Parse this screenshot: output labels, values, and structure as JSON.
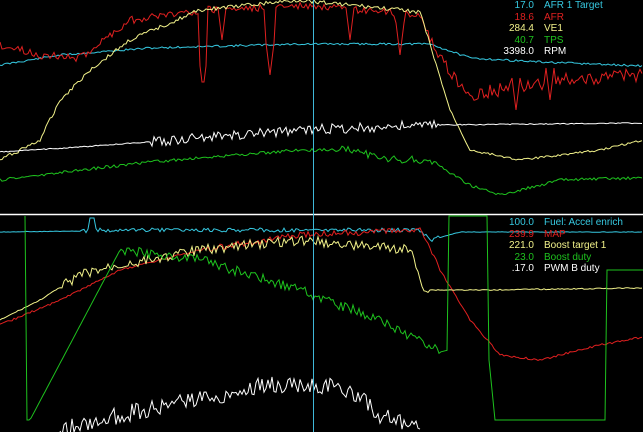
{
  "colors": {
    "background": "#000000",
    "cursor": "#3fb8d8",
    "divider": "#ffffff",
    "cyan": "#36c8e0",
    "red": "#e02020",
    "yellow": "#f2f28a",
    "green": "#1ec21e",
    "white": "#ffffff"
  },
  "panels": [
    {
      "id": "top",
      "channels": [
        {
          "value": "17.0",
          "name": "AFR 1 Target",
          "color": "#36c8e0"
        },
        {
          "value": "18.6",
          "name": "AFR",
          "color": "#e02020"
        },
        {
          "value": "284.4",
          "name": "VE1",
          "color": "#f2f28a"
        },
        {
          "value": "40.7",
          "name": "TPS",
          "color": "#1ec21e"
        },
        {
          "value": "3398.0",
          "name": "RPM",
          "color": "#ffffff"
        }
      ]
    },
    {
      "id": "bottom",
      "channels": [
        {
          "value": "100.0",
          "name": "Fuel: Accel enrich",
          "color": "#36c8e0"
        },
        {
          "value": "239.9",
          "name": "MAP",
          "color": "#e02020"
        },
        {
          "value": "221.0",
          "name": "Boost target 1",
          "color": "#f2f28a"
        },
        {
          "value": "23.0",
          "name": "Boost duty",
          "color": "#1ec21e"
        },
        {
          "value": ".17.0",
          "name": "PWM B duty",
          "color": "#ffffff"
        }
      ]
    }
  ]
}
